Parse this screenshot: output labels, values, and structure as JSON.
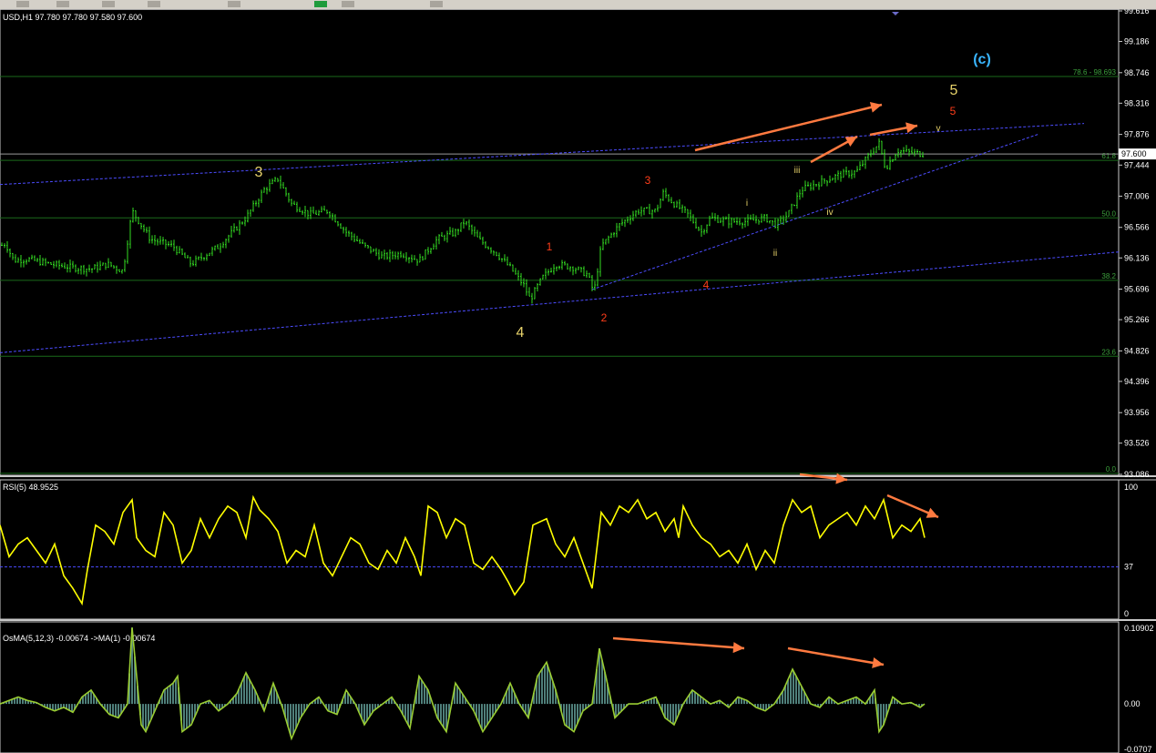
{
  "colors": {
    "background": "#000000",
    "candle": "#33dd22",
    "fib_line": "#1a6a1a",
    "trendline": "#4c4cff",
    "rsi_line": "#ffff00",
    "osma_line": "#9acd32",
    "osma_hist": "#4f7f7a",
    "arrow": "#ff7a40",
    "wave_orange": "#ff3d1a",
    "wave_yellow": "#e8d36a",
    "wave_cyan": "#3ab6ff",
    "axis_text": "#ffffff",
    "separator": "#c8c8c8"
  },
  "toolbar": {
    "icons": [
      "toolbar-icon-1",
      "toolbar-icon-2",
      "toolbar-icon-3",
      "toolbar-icon-4",
      "toolbar-icon-5",
      "new-order-icon",
      "toolbar-icon-7",
      "toolbar-icon-8"
    ]
  },
  "main_panel": {
    "header": "USD,H1  97.780 97.780 97.580 97.600",
    "current_price_label": "97.600",
    "fib_levels": [
      {
        "value": 98.693,
        "label": "78.6 - 98.693"
      },
      {
        "value": 97.51,
        "label": "61.8"
      },
      {
        "value": 96.7,
        "label": "50.0"
      },
      {
        "value": 95.82,
        "label": "38.2"
      },
      {
        "value": 94.75,
        "label": "23.6"
      },
      {
        "value": 93.1,
        "label": "0.0"
      }
    ]
  },
  "rsi_panel": {
    "header": "RSI(5) 48.9525",
    "level_labels": [
      "100",
      "37",
      "0"
    ]
  },
  "osma_panel": {
    "header": "OsMA(5,12,3) -0.00674  ->MA(1) -0.00674",
    "axis_labels": [
      "0.10902",
      "0.00",
      "-0.0707"
    ]
  },
  "wave_labels": [
    {
      "text": "(c)",
      "color": "cyan",
      "size": "large"
    },
    {
      "text": "5",
      "color": "yellow",
      "size": "large"
    },
    {
      "text": "5",
      "color": "orange",
      "size": "small"
    },
    {
      "text": "v",
      "color": "yellow",
      "size": "tiny"
    },
    {
      "text": "3",
      "color": "yellow",
      "size": "large"
    },
    {
      "text": "4",
      "color": "yellow",
      "size": "large"
    },
    {
      "text": "1",
      "color": "orange",
      "size": "small"
    },
    {
      "text": "2",
      "color": "orange",
      "size": "small"
    },
    {
      "text": "3",
      "color": "orange",
      "size": "small"
    },
    {
      "text": "4",
      "color": "orange",
      "size": "small"
    },
    {
      "text": "i",
      "color": "yellow",
      "size": "tiny"
    },
    {
      "text": "ii",
      "color": "yellow",
      "size": "tiny"
    },
    {
      "text": "iii",
      "color": "yellow",
      "size": "tiny"
    },
    {
      "text": "iv",
      "color": "yellow",
      "size": "tiny"
    }
  ],
  "chart_data": [
    {
      "type": "candlestick",
      "title": "USD,H1",
      "ylim": [
        93.086,
        99.616
      ],
      "y_ticks": [
        "99.616",
        "99.186",
        "98.746",
        "98.316",
        "97.876",
        "97.444",
        "97.006",
        "96.566",
        "96.136",
        "95.696",
        "95.266",
        "94.826",
        "94.396",
        "93.956",
        "93.526",
        "93.086"
      ],
      "close_path": [
        {
          "x": 0,
          "y": 96.3
        },
        {
          "x": 6,
          "y": 96.34
        },
        {
          "x": 15,
          "y": 96.1
        },
        {
          "x": 30,
          "y": 96.12
        },
        {
          "x": 55,
          "y": 96.05
        },
        {
          "x": 80,
          "y": 96.0
        },
        {
          "x": 100,
          "y": 95.98
        },
        {
          "x": 118,
          "y": 96.05
        },
        {
          "x": 135,
          "y": 95.95
        },
        {
          "x": 145,
          "y": 96.8
        },
        {
          "x": 165,
          "y": 96.4
        },
        {
          "x": 190,
          "y": 96.3
        },
        {
          "x": 210,
          "y": 96.05
        },
        {
          "x": 240,
          "y": 96.3
        },
        {
          "x": 270,
          "y": 96.7
        },
        {
          "x": 290,
          "y": 97.1
        },
        {
          "x": 305,
          "y": 97.25
        },
        {
          "x": 320,
          "y": 96.9
        },
        {
          "x": 340,
          "y": 96.75
        },
        {
          "x": 360,
          "y": 96.8
        },
        {
          "x": 380,
          "y": 96.5
        },
        {
          "x": 400,
          "y": 96.3
        },
        {
          "x": 420,
          "y": 96.15
        },
        {
          "x": 440,
          "y": 96.2
        },
        {
          "x": 460,
          "y": 96.1
        },
        {
          "x": 480,
          "y": 96.4
        },
        {
          "x": 500,
          "y": 96.5
        },
        {
          "x": 510,
          "y": 96.65
        },
        {
          "x": 525,
          "y": 96.4
        },
        {
          "x": 545,
          "y": 96.2
        },
        {
          "x": 560,
          "y": 96.0
        },
        {
          "x": 575,
          "y": 95.75
        },
        {
          "x": 582,
          "y": 95.55
        },
        {
          "x": 595,
          "y": 95.85
        },
        {
          "x": 610,
          "y": 96.05
        },
        {
          "x": 630,
          "y": 96.0
        },
        {
          "x": 645,
          "y": 95.9
        },
        {
          "x": 652,
          "y": 95.65
        },
        {
          "x": 660,
          "y": 96.3
        },
        {
          "x": 680,
          "y": 96.6
        },
        {
          "x": 700,
          "y": 96.8
        },
        {
          "x": 720,
          "y": 96.8
        },
        {
          "x": 728,
          "y": 97.05
        },
        {
          "x": 740,
          "y": 96.9
        },
        {
          "x": 755,
          "y": 96.75
        },
        {
          "x": 770,
          "y": 96.5
        },
        {
          "x": 780,
          "y": 96.7
        },
        {
          "x": 800,
          "y": 96.65
        },
        {
          "x": 820,
          "y": 96.65
        },
        {
          "x": 840,
          "y": 96.7
        },
        {
          "x": 852,
          "y": 96.6
        },
        {
          "x": 865,
          "y": 96.75
        },
        {
          "x": 880,
          "y": 97.1
        },
        {
          "x": 900,
          "y": 97.2
        },
        {
          "x": 920,
          "y": 97.3
        },
        {
          "x": 940,
          "y": 97.35
        },
        {
          "x": 955,
          "y": 97.6
        },
        {
          "x": 965,
          "y": 97.75
        },
        {
          "x": 972,
          "y": 97.4
        },
        {
          "x": 985,
          "y": 97.65
        },
        {
          "x": 1000,
          "y": 97.62
        },
        {
          "x": 1015,
          "y": 97.6
        }
      ],
      "trendlines": [
        {
          "from": {
            "x": 0,
            "y": 94.8
          },
          "to": {
            "x": 1228,
            "y": 96.22
          }
        },
        {
          "from": {
            "x": 0,
            "y": 97.17
          },
          "to": {
            "x": 1190,
            "y": 98.03
          }
        },
        {
          "from": {
            "x": 650,
            "y": 95.69
          },
          "to": {
            "x": 1140,
            "y": 97.88
          }
        }
      ]
    },
    {
      "type": "line",
      "title": "RSI(5)",
      "ylim": [
        0,
        100
      ],
      "level": 37,
      "x": [
        0,
        10,
        20,
        30,
        40,
        50,
        60,
        70,
        80,
        90,
        96,
        105,
        115,
        125,
        135,
        145,
        150,
        160,
        170,
        180,
        190,
        200,
        210,
        220,
        230,
        240,
        250,
        260,
        270,
        278,
        285,
        295,
        305,
        315,
        325,
        335,
        345,
        355,
        365,
        375,
        385,
        395,
        405,
        415,
        425,
        435,
        445,
        455,
        462,
        470,
        480,
        490,
        500,
        510,
        520,
        530,
        540,
        550,
        558,
        565,
        575,
        585,
        600,
        610,
        620,
        630,
        640,
        650,
        660,
        670,
        680,
        690,
        700,
        710,
        720,
        730,
        740,
        745,
        750,
        760,
        770,
        780,
        790,
        800,
        810,
        820,
        830,
        840,
        850,
        860,
        870,
        880,
        890,
        900,
        910,
        920,
        930,
        940,
        950,
        960,
        970,
        980,
        990,
        1000,
        1010,
        1015
      ],
      "values": [
        70,
        45,
        55,
        60,
        50,
        40,
        55,
        30,
        20,
        8,
        35,
        70,
        65,
        55,
        80,
        90,
        60,
        50,
        45,
        80,
        70,
        40,
        50,
        75,
        60,
        75,
        85,
        80,
        60,
        92,
        82,
        75,
        65,
        40,
        50,
        45,
        70,
        40,
        30,
        45,
        60,
        55,
        40,
        35,
        50,
        40,
        60,
        45,
        30,
        85,
        80,
        60,
        75,
        70,
        40,
        35,
        45,
        35,
        25,
        15,
        25,
        70,
        75,
        55,
        45,
        60,
        40,
        20,
        80,
        70,
        85,
        80,
        90,
        75,
        80,
        65,
        75,
        60,
        85,
        70,
        60,
        55,
        45,
        50,
        40,
        55,
        35,
        50,
        40,
        70,
        90,
        80,
        85,
        60,
        70,
        75,
        80,
        70,
        85,
        75,
        90,
        60,
        70,
        65,
        75,
        60,
        50
      ],
      "area_label_hint": "yellow RSI line"
    },
    {
      "type": "area",
      "title": "OsMA(5,12,3)",
      "ylim": [
        -0.0707,
        0.10902
      ],
      "zero_line": 0.0,
      "x": [
        0,
        10,
        20,
        30,
        40,
        50,
        60,
        70,
        80,
        90,
        100,
        110,
        120,
        130,
        140,
        145,
        150,
        155,
        160,
        170,
        180,
        190,
        195,
        200,
        210,
        220,
        230,
        240,
        250,
        260,
        270,
        280,
        290,
        300,
        310,
        320,
        330,
        340,
        350,
        360,
        370,
        380,
        390,
        400,
        410,
        420,
        430,
        440,
        450,
        460,
        470,
        480,
        490,
        500,
        510,
        520,
        530,
        540,
        550,
        560,
        570,
        580,
        590,
        600,
        610,
        620,
        630,
        640,
        650,
        658,
        665,
        675,
        690,
        700,
        710,
        720,
        730,
        740,
        750,
        760,
        770,
        780,
        790,
        800,
        810,
        820,
        830,
        840,
        850,
        860,
        870,
        880,
        890,
        900,
        910,
        920,
        930,
        940,
        950,
        960,
        965,
        970,
        980,
        990,
        1000,
        1010,
        1015
      ],
      "values": [
        0.0,
        0.005,
        0.01,
        0.005,
        0.002,
        -0.005,
        -0.01,
        -0.005,
        -0.012,
        0.01,
        0.02,
        0.0,
        -0.015,
        -0.02,
        0.0,
        0.11,
        0.04,
        -0.03,
        -0.04,
        -0.01,
        0.02,
        0.03,
        0.04,
        -0.04,
        -0.03,
        0.0,
        0.005,
        -0.01,
        0.0,
        0.015,
        0.045,
        0.02,
        -0.01,
        0.03,
        -0.005,
        -0.05,
        -0.02,
        0.0,
        0.01,
        -0.01,
        -0.015,
        0.02,
        0.0,
        -0.03,
        -0.01,
        0.0,
        0.01,
        -0.01,
        -0.035,
        0.04,
        0.02,
        -0.02,
        -0.04,
        0.03,
        0.01,
        -0.01,
        -0.04,
        -0.02,
        0.0,
        0.03,
        0.0,
        -0.02,
        0.04,
        0.06,
        0.02,
        -0.03,
        -0.04,
        -0.01,
        0.0,
        0.08,
        0.04,
        -0.02,
        0.0,
        0.0,
        0.005,
        0.01,
        -0.02,
        -0.03,
        0.0,
        0.02,
        0.01,
        0.0,
        0.005,
        -0.005,
        0.01,
        0.005,
        -0.005,
        -0.01,
        0.0,
        0.02,
        0.05,
        0.025,
        0.0,
        -0.005,
        0.01,
        0.0,
        0.005,
        0.01,
        0.0,
        0.02,
        -0.04,
        -0.03,
        0.01,
        0.0,
        0.002,
        -0.005,
        0.0
      ]
    }
  ]
}
